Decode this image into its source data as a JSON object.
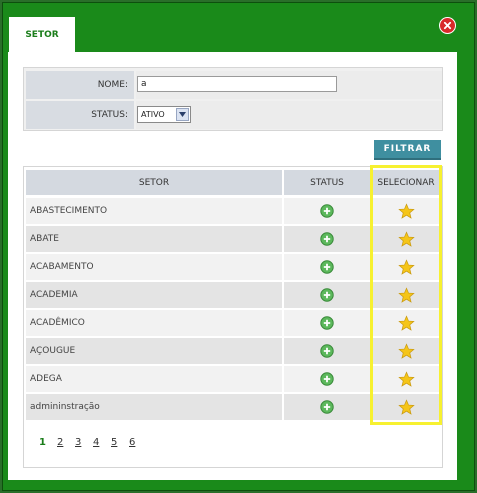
{
  "tab": {
    "label": "SETOR"
  },
  "filter": {
    "name_label": "NOME:",
    "name_value": "a",
    "status_label": "STATUS:",
    "status_value": "ATIVO",
    "button_label": "FILTRAR"
  },
  "table": {
    "headers": [
      "SETOR",
      "STATUS",
      "SELECIONAR"
    ],
    "rows": [
      {
        "setor": "ABASTECIMENTO"
      },
      {
        "setor": "ABATE"
      },
      {
        "setor": "ACABAMENTO"
      },
      {
        "setor": "ACADEMIA"
      },
      {
        "setor": "ACADÊMICO"
      },
      {
        "setor": "AÇOUGUE"
      },
      {
        "setor": "ADEGA"
      },
      {
        "setor": "admininstração"
      }
    ],
    "status_icon": "plus-circle-icon",
    "select_icon": "star-icon"
  },
  "pagination": {
    "pages": [
      "1",
      "2",
      "3",
      "4",
      "5",
      "6"
    ],
    "current": "1"
  },
  "colors": {
    "frame_green": "#1a8a1a",
    "button_teal": "#3f8fa0",
    "highlight_yellow": "#f7f130",
    "close_red": "#d82a2a"
  }
}
